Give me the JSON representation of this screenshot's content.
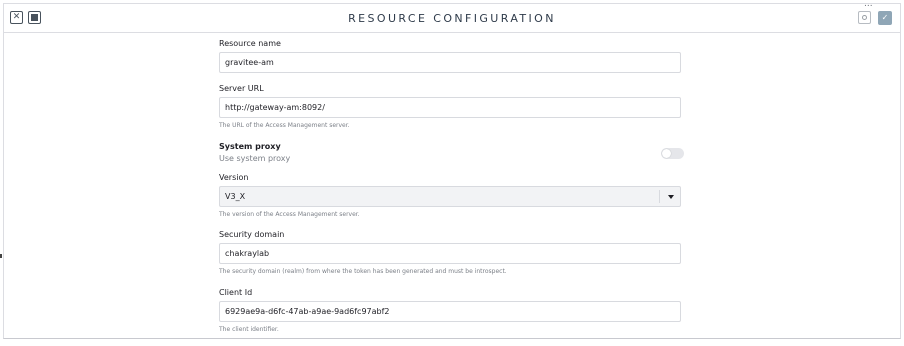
{
  "header": {
    "title": "RESOURCE CONFIGURATION",
    "close_glyph": "✕",
    "save_glyph": "✓",
    "more_glyph": "..."
  },
  "form": {
    "resource_name": {
      "label": "Resource name",
      "value": "gravitee-am"
    },
    "server_url": {
      "label": "Server URL",
      "value": "http://gateway-am:8092/",
      "hint": "The URL of the Access Management server."
    },
    "system_proxy": {
      "label": "System proxy",
      "description": "Use system proxy",
      "enabled": false
    },
    "version": {
      "label": "Version",
      "value": "V3_X",
      "hint": "The version of the Access Management server."
    },
    "security_domain": {
      "label": "Security domain",
      "value": "chakraylab",
      "hint": "The security domain (realm) from where the token has been generated and must be introspect."
    },
    "client_id": {
      "label": "Client Id",
      "value": "6929ae9a-d6fc-47ab-a9ae-9ad6fc97abf2",
      "hint": "The client identifier."
    }
  }
}
